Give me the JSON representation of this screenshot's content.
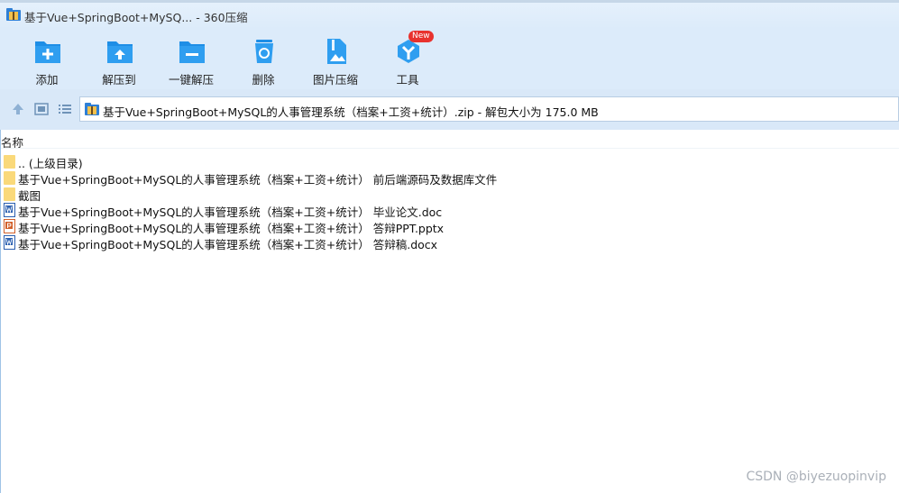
{
  "window": {
    "title": "基于Vue+SpringBoot+MySQ... - 360压缩"
  },
  "toolbar": {
    "buttons": [
      {
        "label": "添加",
        "icon": "add-folder-icon"
      },
      {
        "label": "解压到",
        "icon": "extract-to-icon"
      },
      {
        "label": "一键解压",
        "icon": "one-click-extract-icon"
      },
      {
        "label": "删除",
        "icon": "recycle-bin-icon"
      },
      {
        "label": "图片压缩",
        "icon": "image-compress-icon"
      },
      {
        "label": "工具",
        "icon": "tools-icon",
        "badge": "New"
      }
    ]
  },
  "navigation": {
    "path": "基于Vue+SpringBoot+MySQL的人事管理系统（档案+工资+统计）.zip - 解包大小为 175.0 MB"
  },
  "file_list": {
    "column_name": "名称",
    "rows": [
      {
        "name": ".. (上级目录)",
        "type": "folder"
      },
      {
        "name": "基于Vue+SpringBoot+MySQL的人事管理系统（档案+工资+统计） 前后端源码及数据库文件",
        "type": "folder"
      },
      {
        "name": "截图",
        "type": "folder"
      },
      {
        "name": "基于Vue+SpringBoot+MySQL的人事管理系统（档案+工资+统计） 毕业论文.doc",
        "type": "word"
      },
      {
        "name": "基于Vue+SpringBoot+MySQL的人事管理系统（档案+工资+统计） 答辩PPT.pptx",
        "type": "ppt"
      },
      {
        "name": "基于Vue+SpringBoot+MySQL的人事管理系统（档案+工资+统计） 答辩稿.docx",
        "type": "word"
      }
    ]
  },
  "watermark": "CSDN @biyezuopinvip",
  "colors": {
    "toolbar_bg": "#dcebfa",
    "icon_blue": "#1e8ee6",
    "badge_red": "#e8322e"
  }
}
